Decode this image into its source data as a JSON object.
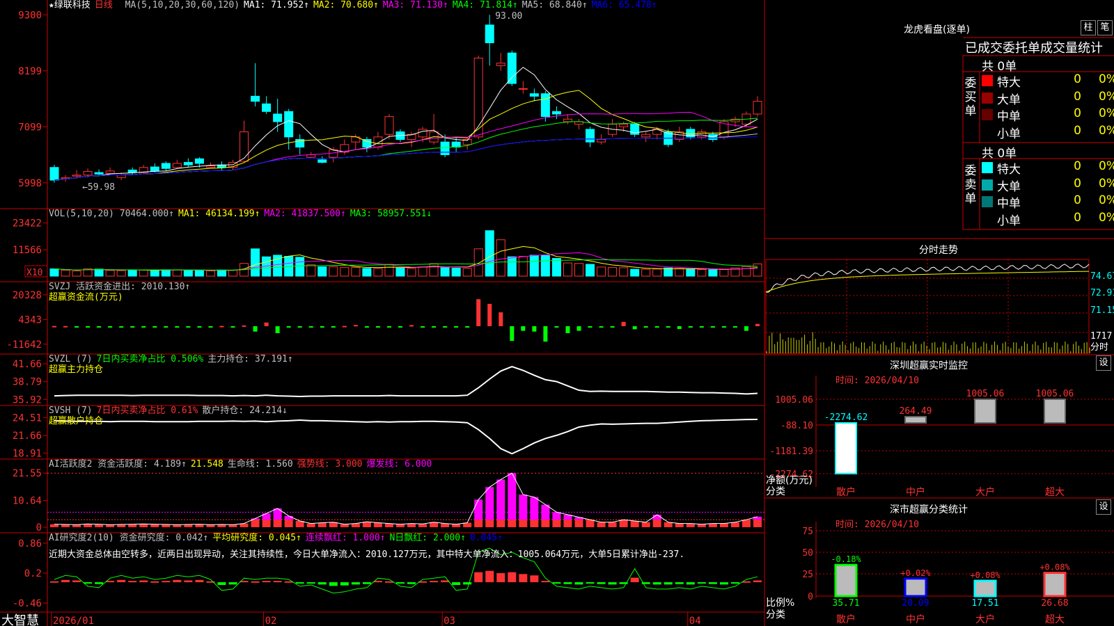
{
  "stock": {
    "name": "★绿联科技",
    "period": "日线"
  },
  "colors": {
    "up": "#ff3232",
    "down": "#00ffff",
    "grid": "#cc0000",
    "green": "#00ff00"
  },
  "chart_data": [
    {
      "type": "candlestick",
      "name": "price",
      "ylim": [
        5900,
        9400
      ],
      "ticks": [
        9300,
        8199,
        7099,
        5998
      ],
      "annotations": [
        "93.00",
        "59.98"
      ],
      "candles": [
        [
          6300,
          6050,
          6350,
          6000
        ],
        [
          6080,
          6100,
          6150,
          6020
        ],
        [
          6130,
          6150,
          6250,
          6080
        ],
        [
          6150,
          6220,
          6280,
          6100
        ],
        [
          6200,
          6170,
          6260,
          6130
        ],
        [
          6180,
          6230,
          6300,
          6150
        ],
        [
          6100,
          6150,
          6200,
          6050
        ],
        [
          6250,
          6200,
          6300,
          6150
        ],
        [
          6200,
          6300,
          6350,
          6180
        ],
        [
          6310,
          6230,
          6380,
          6200
        ],
        [
          6380,
          6280,
          6420,
          6230
        ],
        [
          6300,
          6380,
          6450,
          6280
        ],
        [
          6400,
          6350,
          6480,
          6300
        ],
        [
          6470,
          6380,
          6500,
          6300
        ],
        [
          6300,
          6330,
          6400,
          6280
        ],
        [
          6350,
          6300,
          6420,
          6250
        ],
        [
          6300,
          6400,
          6450,
          6250
        ],
        [
          6420,
          7000,
          7220,
          6400
        ],
        [
          7700,
          7600,
          8350,
          7500
        ],
        [
          7550,
          7400,
          7700,
          7350
        ],
        [
          7350,
          7200,
          7650,
          7000
        ],
        [
          7400,
          6900,
          7450,
          6650
        ],
        [
          6850,
          6700,
          6950,
          6550
        ],
        [
          6500,
          6550,
          6600,
          6480
        ],
        [
          6450,
          6400,
          6520,
          6380
        ],
        [
          6500,
          6650,
          6700,
          6400
        ],
        [
          6600,
          6750,
          6850,
          6550
        ],
        [
          6800,
          6900,
          6950,
          6650
        ],
        [
          6850,
          6700,
          6900,
          6600
        ],
        [
          6700,
          6900,
          7000,
          6650
        ],
        [
          6950,
          7300,
          7350,
          6850
        ],
        [
          7000,
          6850,
          7050,
          6800
        ],
        [
          6850,
          6950,
          7000,
          6700
        ],
        [
          6900,
          7050,
          7100,
          6800
        ],
        [
          6800,
          7000,
          7350,
          6750
        ],
        [
          6800,
          6550,
          6950,
          6500
        ],
        [
          6800,
          6700,
          6900,
          6600
        ],
        [
          6750,
          6850,
          6900,
          6650
        ],
        [
          6900,
          8450,
          8500,
          6850
        ],
        [
          9100,
          8750,
          9300,
          8300
        ],
        [
          8300,
          8350,
          8550,
          8200
        ],
        [
          8550,
          7950,
          8600,
          7900
        ],
        [
          7850,
          7850,
          8000,
          7750
        ],
        [
          7750,
          7700,
          7850,
          7600
        ],
        [
          7750,
          7300,
          7800,
          7200
        ],
        [
          7400,
          7350,
          7500,
          7250
        ],
        [
          7200,
          7250,
          7350,
          7150
        ],
        [
          7150,
          7200,
          7250,
          7050
        ],
        [
          7050,
          6800,
          7100,
          6700
        ],
        [
          6800,
          6850,
          6950,
          6750
        ],
        [
          6950,
          7150,
          7250,
          6900
        ],
        [
          7100,
          7150,
          7200,
          7000
        ],
        [
          7150,
          6950,
          7200,
          6900
        ],
        [
          6900,
          6950,
          7000,
          6800
        ],
        [
          6950,
          7050,
          7100,
          6850
        ],
        [
          7000,
          6750,
          7050,
          6700
        ],
        [
          6850,
          7000,
          7100,
          6800
        ],
        [
          7050,
          6900,
          7100,
          6850
        ],
        [
          6900,
          7000,
          7050,
          6850
        ],
        [
          6950,
          6850,
          7000,
          6800
        ],
        [
          6900,
          7200,
          7250,
          6850
        ],
        [
          7200,
          7250,
          7300,
          7100
        ],
        [
          7150,
          7350,
          7400,
          7100
        ],
        [
          7350,
          7600,
          7700,
          7300
        ]
      ],
      "legend": [
        {
          "label": "MA(5,10,20,30,60,120)",
          "value": "",
          "color": "#c0c0c0"
        },
        {
          "label": "MA1:",
          "value": "71.952↑",
          "color": "#ffffff"
        },
        {
          "label": "MA2:",
          "value": "70.680↑",
          "color": "#ffff00"
        },
        {
          "label": "MA3:",
          "value": "71.130↑",
          "color": "#ff00ff"
        },
        {
          "label": "MA4:",
          "value": "71.814↑",
          "color": "#00ff00"
        },
        {
          "label": "MA5:",
          "value": "68.840↑",
          "color": "#c0c0c0"
        },
        {
          "label": "MA6:",
          "value": "65.478↑",
          "color": "#0000ff"
        }
      ]
    },
    {
      "type": "bar",
      "name": "volume",
      "ylim": [
        0,
        26000
      ],
      "ticks": [
        23422,
        11566
      ],
      "unit": "X10",
      "values": [
        3200,
        2600,
        2300,
        3300,
        3100,
        2500,
        2400,
        2600,
        2700,
        2700,
        2800,
        2800,
        2500,
        2500,
        2300,
        2700,
        2600,
        5600,
        12000,
        8500,
        9200,
        8700,
        8300,
        5000,
        4100,
        4100,
        3900,
        3800,
        3400,
        3400,
        5200,
        3600,
        3400,
        4100,
        5500,
        3700,
        3500,
        3400,
        12000,
        20000,
        16000,
        8500,
        8700,
        9200,
        9100,
        7800,
        5800,
        5600,
        5200,
        4000,
        3800,
        3700,
        3000,
        3000,
        3100,
        3600,
        3400,
        3100,
        2900,
        2800,
        2900,
        3600,
        4200,
        5400
      ],
      "legend": [
        {
          "label": "VOL(5,10,20)",
          "value": "70464.000↑",
          "color": "#c0c0c0"
        },
        {
          "label": "MA1:",
          "value": "46134.199↑",
          "color": "#ffff00"
        },
        {
          "label": "MA2:",
          "value": "41837.500↑",
          "color": "#ff00ff"
        },
        {
          "label": "MA3:",
          "value": "58957.551↓",
          "color": "#00ff00"
        }
      ]
    },
    {
      "type": "bar",
      "name": "超赢资金流(万元)",
      "ylim": [
        -14000,
        23000
      ],
      "ticks": [
        20328,
        4343,
        -11642
      ],
      "values": [
        150,
        120,
        -500,
        -300,
        -250,
        -500,
        -400,
        -300,
        -250,
        -300,
        -400,
        -350,
        -300,
        -250,
        -300,
        200,
        -250,
        500,
        -3500,
        2400,
        -4500,
        -500,
        -400,
        -450,
        -700,
        -400,
        200,
        800,
        -350,
        -500,
        -300,
        -300,
        700,
        -250,
        -800,
        -300,
        -200,
        -250,
        17500,
        14500,
        9000,
        -9500,
        -3000,
        -3500,
        -10000,
        -300,
        -4500,
        -3000,
        -300,
        -200,
        -400,
        2800,
        -2000,
        -300,
        -250,
        -200,
        -1800,
        -250,
        -200,
        -300,
        -150,
        -200,
        -3000,
        1500
      ],
      "legend": [
        {
          "label": "SVZJ  活跃资金进出:",
          "value": "2010.130↑",
          "color": "#c0c0c0"
        }
      ]
    },
    {
      "type": "line",
      "name": "超赢主力持仓",
      "ylim": [
        35.5,
        42
      ],
      "ticks": [
        41.66,
        38.79,
        35.92
      ],
      "values": [
        36.5,
        36.55,
        36.6,
        36.6,
        36.6,
        36.6,
        36.6,
        36.55,
        36.6,
        36.6,
        36.6,
        36.6,
        36.6,
        36.55,
        36.55,
        36.55,
        36.5,
        36.55,
        36.5,
        36.6,
        36.5,
        36.45,
        36.4,
        36.45,
        36.45,
        36.5,
        36.5,
        36.5,
        36.5,
        36.5,
        36.55,
        36.5,
        36.5,
        36.5,
        36.5,
        36.5,
        36.5,
        36.6,
        37.8,
        39.2,
        40.5,
        41.2,
        40.6,
        39.8,
        39.1,
        38.8,
        38.1,
        37.4,
        37.2,
        37.25,
        37.2,
        37.2,
        37.2,
        37.2,
        37.15,
        37.1,
        37.1,
        37.05,
        37.0,
        37.0,
        36.95,
        36.9,
        36.8,
        36.9
      ],
      "legend": [
        {
          "label": "SVZL (7)",
          "value": "",
          "color": "#c0c0c0"
        },
        {
          "label": "7日内买卖净占比",
          "value": "0.506%",
          "color": "#00ff00"
        },
        {
          "label": "主力持仓:",
          "value": "37.191↑",
          "color": "#c0c0c0"
        }
      ]
    },
    {
      "type": "line",
      "name": "超赢散户持仓",
      "ylim": [
        18.5,
        25.2
      ],
      "ticks": [
        24.51,
        21.66,
        18.91
      ],
      "values": [
        24.0,
        23.95,
        23.9,
        23.9,
        23.9,
        23.85,
        23.9,
        23.9,
        23.9,
        23.85,
        23.85,
        23.85,
        23.85,
        23.9,
        23.9,
        23.9,
        23.95,
        23.9,
        23.95,
        23.85,
        23.95,
        24.0,
        24.1,
        24.0,
        24.0,
        23.95,
        23.9,
        23.85,
        23.8,
        23.85,
        23.8,
        23.85,
        23.85,
        23.9,
        23.9,
        23.85,
        23.8,
        23.7,
        22.6,
        21.2,
        19.6,
        18.8,
        19.6,
        20.5,
        21.2,
        21.7,
        22.3,
        23.0,
        23.3,
        23.5,
        23.45,
        23.5,
        23.55,
        23.6,
        23.6,
        23.7,
        23.8,
        23.9,
        24.0,
        24.05,
        24.1,
        24.15,
        24.2,
        24.21
      ],
      "legend": [
        {
          "label": "SVSH (7)",
          "value": "",
          "color": "#c0c0c0"
        },
        {
          "label": "7日内买卖净占比",
          "value": "0.61%",
          "color": "#ff3232"
        },
        {
          "label": "散户持仓:",
          "value": "24.214↓",
          "color": "#c0c0c0"
        }
      ]
    },
    {
      "type": "bar",
      "name": "AI活跃度2",
      "ylim": [
        0,
        23
      ],
      "ticks": [
        21.55,
        10.64,
        0.0
      ],
      "values": [
        1.2,
        1.1,
        1.0,
        1.3,
        1.2,
        1.0,
        1.1,
        1.2,
        1.3,
        1.2,
        1.1,
        1.0,
        1.1,
        1.2,
        1.0,
        1.1,
        1.0,
        1.5,
        3.5,
        5.5,
        7.5,
        4.5,
        2.5,
        1.5,
        1.8,
        2.0,
        1.2,
        1.5,
        2.2,
        1.8,
        1.5,
        1.2,
        1.5,
        1.3,
        2.0,
        1.5,
        1.2,
        1.8,
        11,
        16,
        19,
        21.55,
        13,
        12,
        9,
        6,
        5,
        4,
        3,
        2,
        2,
        3,
        2.5,
        2,
        5,
        2,
        1.5,
        1.5,
        1.2,
        1.5,
        1.5,
        2,
        3,
        4.2
      ],
      "legend": [
        {
          "label": "AI活跃度2 资金活跃度:",
          "value": "4.189↑",
          "color": "#c0c0c0"
        },
        {
          "label": "",
          "value": "21.548",
          "color": "#ffff00"
        },
        {
          "label": "生命线:",
          "value": "1.560",
          "color": "#c0c0c0"
        },
        {
          "label": "强势线:",
          "value": "3.000",
          "color": "#ff3232"
        },
        {
          "label": "爆发线:",
          "value": "6.000",
          "color": "#ff00ff"
        }
      ]
    },
    {
      "type": "bar",
      "name": "AI研究度2(10)",
      "ylim": [
        -0.55,
        0.95
      ],
      "ticks": [
        0.86,
        0.2,
        -0.46
      ],
      "values": [
        0.02,
        0.05,
        0.04,
        -0.03,
        -0.04,
        0.03,
        0.05,
        0.03,
        0.04,
        0.02,
        0.03,
        0.05,
        0.04,
        0.05,
        0.02,
        -0.06,
        -0.05,
        0.03,
        0.02,
        0.03,
        0.03,
        0.02,
        -0.03,
        -0.02,
        -0.05,
        -0.08,
        -0.07,
        -0.05,
        -0.04,
        0.03,
        0.02,
        -0.03,
        -0.04,
        0.02,
        0.03,
        0.04,
        -0.06,
        -0.05,
        0.22,
        0.25,
        0.2,
        0.22,
        0.18,
        0.15,
        0.03,
        -0.03,
        -0.04,
        -0.05,
        -0.03,
        -0.04,
        -0.05,
        -0.04,
        0.1,
        -0.04,
        -0.05,
        -0.05,
        -0.04,
        -0.05,
        -0.03,
        -0.04,
        -0.05,
        -0.03,
        0.02,
        0.04
      ],
      "legend": [
        {
          "label": "AI研究度2(10) 资金研究度:",
          "value": "0.042↑",
          "color": "#c0c0c0"
        },
        {
          "label": "平均研究度:",
          "value": "0.045↑",
          "color": "#ffff00"
        },
        {
          "label": "连续飘红:",
          "value": "1.000↑",
          "color": "#ff00ff"
        },
        {
          "label": "N日飘红:",
          "value": "2.000↑",
          "color": "#00ff00"
        },
        {
          "label": "",
          "value": "0.045↑",
          "color": "#0000ff"
        }
      ]
    },
    {
      "type": "line",
      "name": "分时走势",
      "ticks": [
        "74.67",
        "72.91",
        "71.15",
        "1717",
        "分时"
      ]
    },
    {
      "type": "bar",
      "name": "深圳超赢实时监控",
      "date": "时间: 2026/04/10",
      "ticks": [
        "1005.06",
        "-88.10",
        "-1181.39",
        "-2274.62"
      ],
      "categories": [
        "散户",
        "中户",
        "大户",
        "超大"
      ],
      "values": [
        -2274.62,
        264.49,
        1005.06,
        1005.06
      ],
      "labels": [
        "-2274.62",
        "264.49",
        "1005.06",
        "1005.06"
      ],
      "ylabel": "净额(万元)",
      "xlabel": "分类"
    },
    {
      "type": "bar",
      "name": "深市超赢分类统计",
      "date": "时间: 2026/04/10",
      "ticks": [
        "75",
        "50",
        "25",
        "0"
      ],
      "categories": [
        "散户",
        "中户",
        "大户",
        "超大"
      ],
      "values": [
        35.71,
        20.09,
        17.51,
        26.68
      ],
      "labels": [
        "35.71",
        "20.09",
        "17.51",
        "26.68"
      ],
      "change": [
        "-0.18%",
        "+0.02%",
        "+0.08%",
        "+0.08%"
      ],
      "ylabel": "比例%",
      "xlabel": "分类"
    }
  ],
  "x_axis": {
    "labels": [
      "2026/01",
      "02",
      "03",
      "04"
    ]
  },
  "brand": "大智慧",
  "ai_text": "近期大资金总体由空转多，近两日出现异动，关注其持续性，今日大单净流入：2010.127万元，其中特大单净流入：1005.064万元，大单5日累计净出-237.",
  "dragon_tiger": {
    "title": "龙虎看盘(逐单)",
    "buttons": [
      "柱",
      "笔"
    ],
    "subtitle": "已成交委托单成交量统计",
    "buy": {
      "vlabel": "委买单",
      "total": "共 0单",
      "rows": [
        {
          "name": "特大",
          "n": "0",
          "p": "0%"
        },
        {
          "name": "大单",
          "n": "0",
          "p": "0%"
        },
        {
          "name": "中单",
          "n": "0",
          "p": "0%"
        },
        {
          "name": "小单",
          "n": "0",
          "p": "0%"
        }
      ]
    },
    "sell": {
      "vlabel": "委卖单",
      "total": "共 0单",
      "rows": [
        {
          "name": "特大",
          "n": "0",
          "p": "0%"
        },
        {
          "name": "大单",
          "n": "0",
          "p": "0%"
        },
        {
          "name": "中单",
          "n": "0",
          "p": "0%"
        },
        {
          "name": "小单",
          "n": "0",
          "p": "0%"
        }
      ]
    }
  },
  "panels": {
    "settings": "设"
  }
}
